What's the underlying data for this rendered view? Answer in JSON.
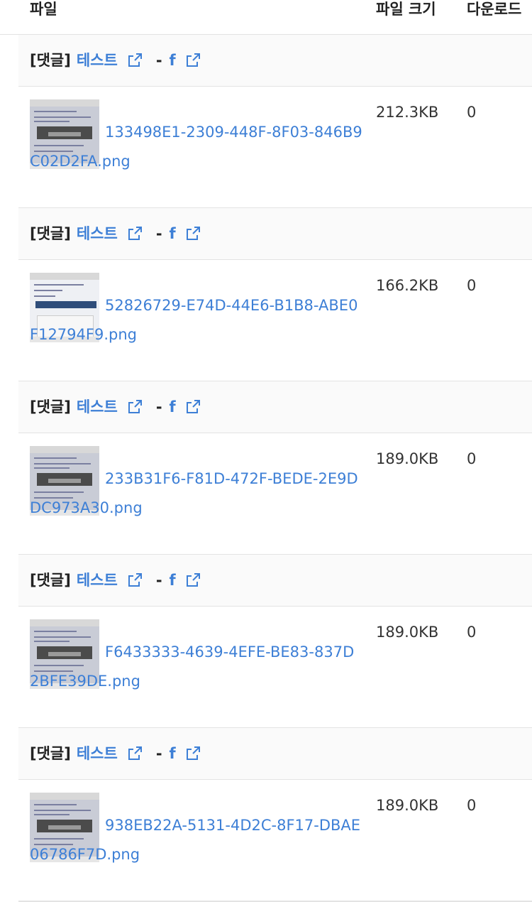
{
  "table": {
    "headers": {
      "file": "파일",
      "size": "파일 크기",
      "downloads": "다운로드"
    },
    "groups": [
      {
        "tag": "[댓글]",
        "post_link": "테스트",
        "separator": "-",
        "author_link": "f",
        "file_name": "133498E1-2309-448F-8F03-846B9C02D2FA.png",
        "size": "212.3KB",
        "downloads": "0"
      },
      {
        "tag": "[댓글]",
        "post_link": "테스트",
        "separator": "-",
        "author_link": "f",
        "file_name": "52826729-E74D-44E6-B1B8-ABE0F12794F9.png",
        "size": "166.2KB",
        "downloads": "0"
      },
      {
        "tag": "[댓글]",
        "post_link": "테스트",
        "separator": "-",
        "author_link": "f",
        "file_name": "233B31F6-F81D-472F-BEDE-2E9DDC973A30.png",
        "size": "189.0KB",
        "downloads": "0"
      },
      {
        "tag": "[댓글]",
        "post_link": "테스트",
        "separator": "-",
        "author_link": "f",
        "file_name": "F6433333-4639-4EFE-BE83-837D2BFE39DE.png",
        "size": "189.0KB",
        "downloads": "0"
      },
      {
        "tag": "[댓글]",
        "post_link": "테스트",
        "separator": "-",
        "author_link": "f",
        "file_name": "938EB22A-5131-4D2C-8F17-DBAE06786F7D.png",
        "size": "189.0KB",
        "downloads": "0"
      }
    ]
  },
  "icons": {
    "external_link": "external-link-icon",
    "thumbnail": "screenshot-thumbnail"
  },
  "colors": {
    "link": "#3d7fd6",
    "border": "#e3e3e3",
    "text": "#333333"
  }
}
